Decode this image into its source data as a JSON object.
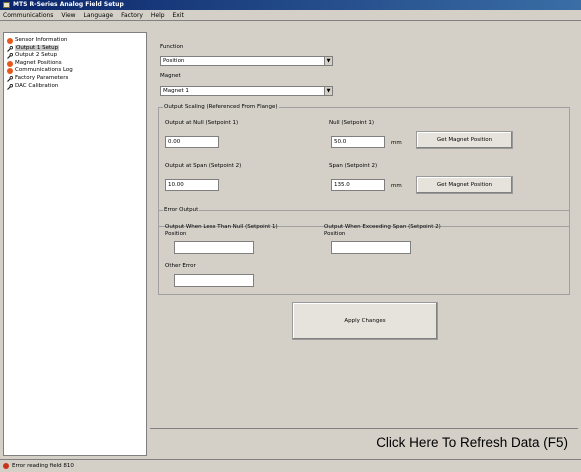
{
  "window": {
    "title": "MTS R-Series Analog Field Setup"
  },
  "menu": [
    "Communications",
    "View",
    "Language",
    "Factory",
    "Help",
    "Exit"
  ],
  "sidebar": {
    "items": [
      {
        "label": "Sensor Information",
        "icon": "error-icon"
      },
      {
        "label": "Output 1 Setup",
        "icon": "wrench-icon",
        "selected": true
      },
      {
        "label": "Output 2 Setup",
        "icon": "wrench-icon"
      },
      {
        "label": "Magnet Positions",
        "icon": "error-icon"
      },
      {
        "label": "Communications Log",
        "icon": "error-icon"
      },
      {
        "label": "Factory Parameters",
        "icon": "wrench-icon"
      },
      {
        "label": "DAC Calibration",
        "icon": "wrench-icon"
      }
    ]
  },
  "form": {
    "function_label": "Function",
    "function_value": "Position",
    "magnet_label": "Magnet",
    "magnet_value": "Magnet 1",
    "output_scaling": {
      "title": "Output Scaling (Referenced From Flange)",
      "null_output_label": "Output at Null (Setpoint 1)",
      "null_output_value": "0.00",
      "null_label": "Null (Setpoint 1)",
      "null_value": "50.0",
      "null_unit": "mm",
      "span_output_label": "Output at Span (Setpoint 2)",
      "span_output_value": "10.00",
      "span_label": "Span (Setpoint 2)",
      "span_value": "135.0",
      "span_unit": "mm",
      "get_magnet_position_label": "Get Magnet Position"
    },
    "error_output": {
      "title": "Error Output",
      "less_than_null_label": "Output When Less Than Null (Setpoint 1)",
      "less_than_null_sub": "Position",
      "less_than_null_value": "",
      "exceeding_span_label": "Output When Exceeding Span (Setpoint 2)",
      "exceeding_span_sub": "Position",
      "exceeding_span_value": "",
      "other_error_label": "Other Error",
      "other_error_value": ""
    },
    "apply_label": "Apply Changes"
  },
  "refresh_label": "Click Here To Refresh Data (F5)",
  "status": {
    "text": "Error reading field 810"
  }
}
